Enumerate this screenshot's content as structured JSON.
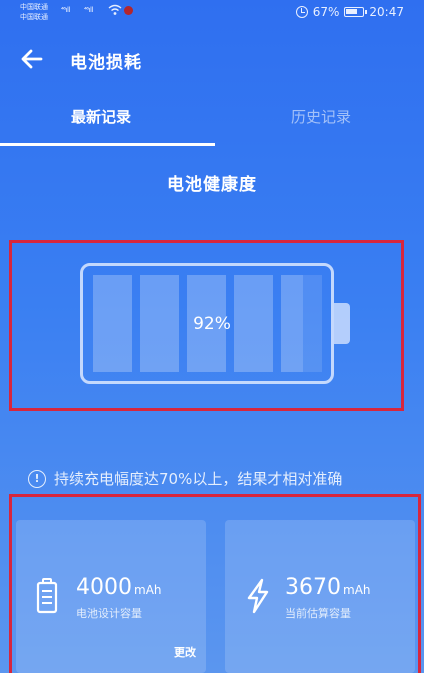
{
  "status_bar": {
    "carrier_1": "中国联通",
    "carrier_2": "中国联通",
    "signal_1": "⁴⁶ıll",
    "signal_2": "⁴⁶ıll",
    "battery_percent": "67%",
    "time": "20:47"
  },
  "header": {
    "title": "电池损耗"
  },
  "tabs": [
    {
      "label": "最新记录",
      "active": true
    },
    {
      "label": "历史记录",
      "active": false
    }
  ],
  "health": {
    "title": "电池健康度",
    "percent_label": "92%",
    "level": 0.92
  },
  "notice": {
    "text": "持续充电幅度达70%以上，结果才相对准确"
  },
  "cards": [
    {
      "value": "4000",
      "unit": "mAh",
      "label": "电池设计容量",
      "action": "更改",
      "icon": "battery-icon"
    },
    {
      "value": "3670",
      "unit": "mAh",
      "label": "当前估算容量",
      "icon": "lightning-icon"
    }
  ],
  "colors": {
    "background_top": "#2f6ff0",
    "background_bottom": "#5b96ef",
    "highlight_box": "#d7263d"
  }
}
